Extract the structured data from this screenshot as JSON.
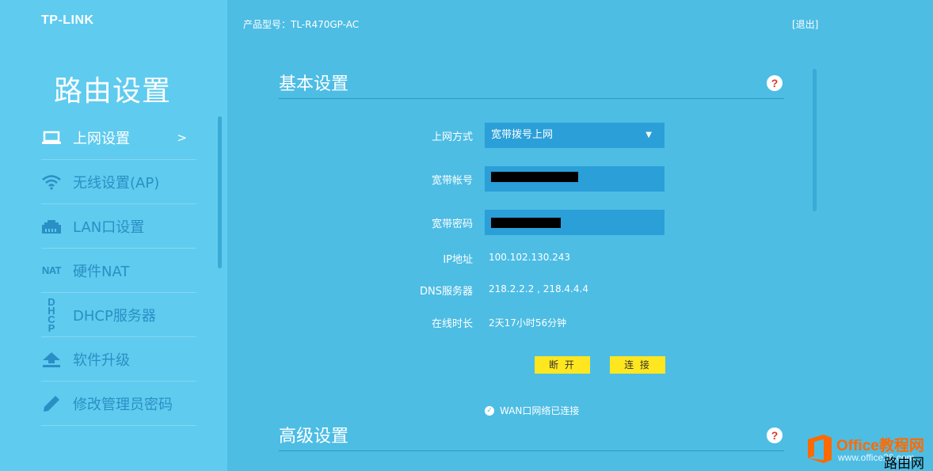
{
  "header": {
    "logo": "TP-LINK",
    "model_label": "产品型号：TL-R470GP-AC",
    "logout": "[退出]"
  },
  "sidebar": {
    "title": "路由设置",
    "items": [
      {
        "label": "上网设置",
        "icon": "laptop-icon",
        "active": true,
        "arrow": ">"
      },
      {
        "label": "无线设置(AP)",
        "icon": "wifi-icon"
      },
      {
        "label": "LAN口设置",
        "icon": "lan-port-icon"
      },
      {
        "label": "硬件NAT",
        "icon": "nat-icon",
        "icon_text": "NAT"
      },
      {
        "label": "DHCP服务器",
        "icon": "dhcp-icon",
        "icon_text": "DHCP"
      },
      {
        "label": "软件升级",
        "icon": "upload-icon"
      },
      {
        "label": "修改管理员密码",
        "icon": "pencil-icon"
      }
    ]
  },
  "basic": {
    "title": "基本设置",
    "help": "?",
    "fields": {
      "mode": {
        "label": "上网方式",
        "value": "宽带拨号上网"
      },
      "account": {
        "label": "宽带帐号"
      },
      "password": {
        "label": "宽带密码"
      },
      "ip": {
        "label": "IP地址",
        "value": "100.102.130.243"
      },
      "dns": {
        "label": "DNS服务器",
        "value": "218.2.2.2 , 218.4.4.4"
      },
      "uptime": {
        "label": "在线时长",
        "value": "2天17小时56分钟"
      }
    },
    "buttons": {
      "disconnect": "断 开",
      "connect": "连 接"
    },
    "status": "WAN口网络已连接"
  },
  "advanced": {
    "title": "高级设置",
    "help": "?"
  },
  "watermark": {
    "brand": "Office教程网",
    "site": "www.office26.com",
    "brand2": "路由网"
  },
  "colors": {
    "sidebar_bg": "#5fcbef",
    "main_bg": "#4dbde4",
    "field_bg": "#2b9fd8",
    "button_bg": "#ffe71f",
    "help_mark": "#d43a2a"
  }
}
